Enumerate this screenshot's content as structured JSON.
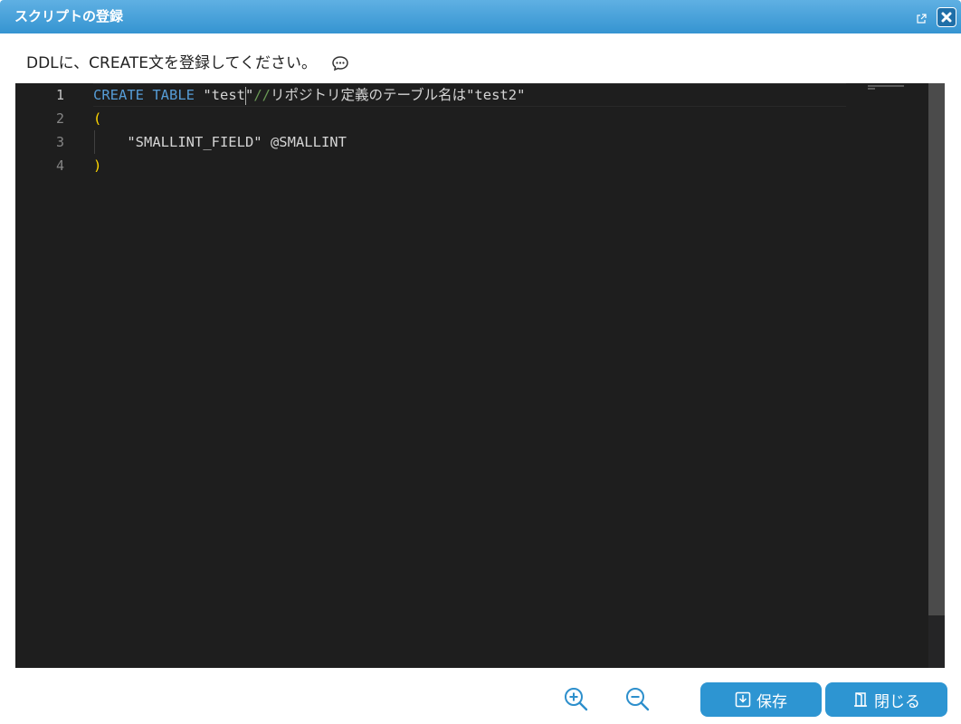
{
  "dialog": {
    "title": "スクリプトの登録"
  },
  "instruction": {
    "text": "DDLに、CREATE文を登録してください。"
  },
  "editor": {
    "line_numbers": [
      "1",
      "2",
      "3",
      "4"
    ],
    "lines": [
      {
        "tokens": [
          {
            "type": "kw",
            "text": "CREATE TABLE"
          },
          {
            "type": "plain",
            "text": " "
          },
          {
            "type": "plain",
            "text": "\"test"
          },
          {
            "type": "cursor",
            "text": ""
          },
          {
            "type": "plain",
            "text": "\""
          },
          {
            "type": "cmt",
            "text": "//"
          },
          {
            "type": "plain",
            "text": "リポジトリ定義のテーブル名は\"test2\""
          }
        ]
      },
      {
        "tokens": [
          {
            "type": "bracket",
            "text": "("
          }
        ]
      },
      {
        "tokens": [
          {
            "type": "plain",
            "text": "    \"SMALLINT_FIELD\" @SMALLINT"
          }
        ]
      },
      {
        "tokens": [
          {
            "type": "bracket",
            "text": ")"
          }
        ]
      }
    ]
  },
  "toolbar": {
    "save_label": "保存",
    "close_label": "閉じる"
  },
  "icons": {
    "popout": "popout-icon",
    "close": "close-icon",
    "comment": "comment-icon",
    "zoom_in": "zoom-in-icon",
    "zoom_out": "zoom-out-icon",
    "save": "save-icon",
    "exit": "exit-door-icon"
  },
  "colors": {
    "titlebar": "#3594d1",
    "button": "#2d95d2",
    "editor_bg": "#1e1e1e",
    "keyword": "#569cd6",
    "bracket": "#ffd700"
  }
}
